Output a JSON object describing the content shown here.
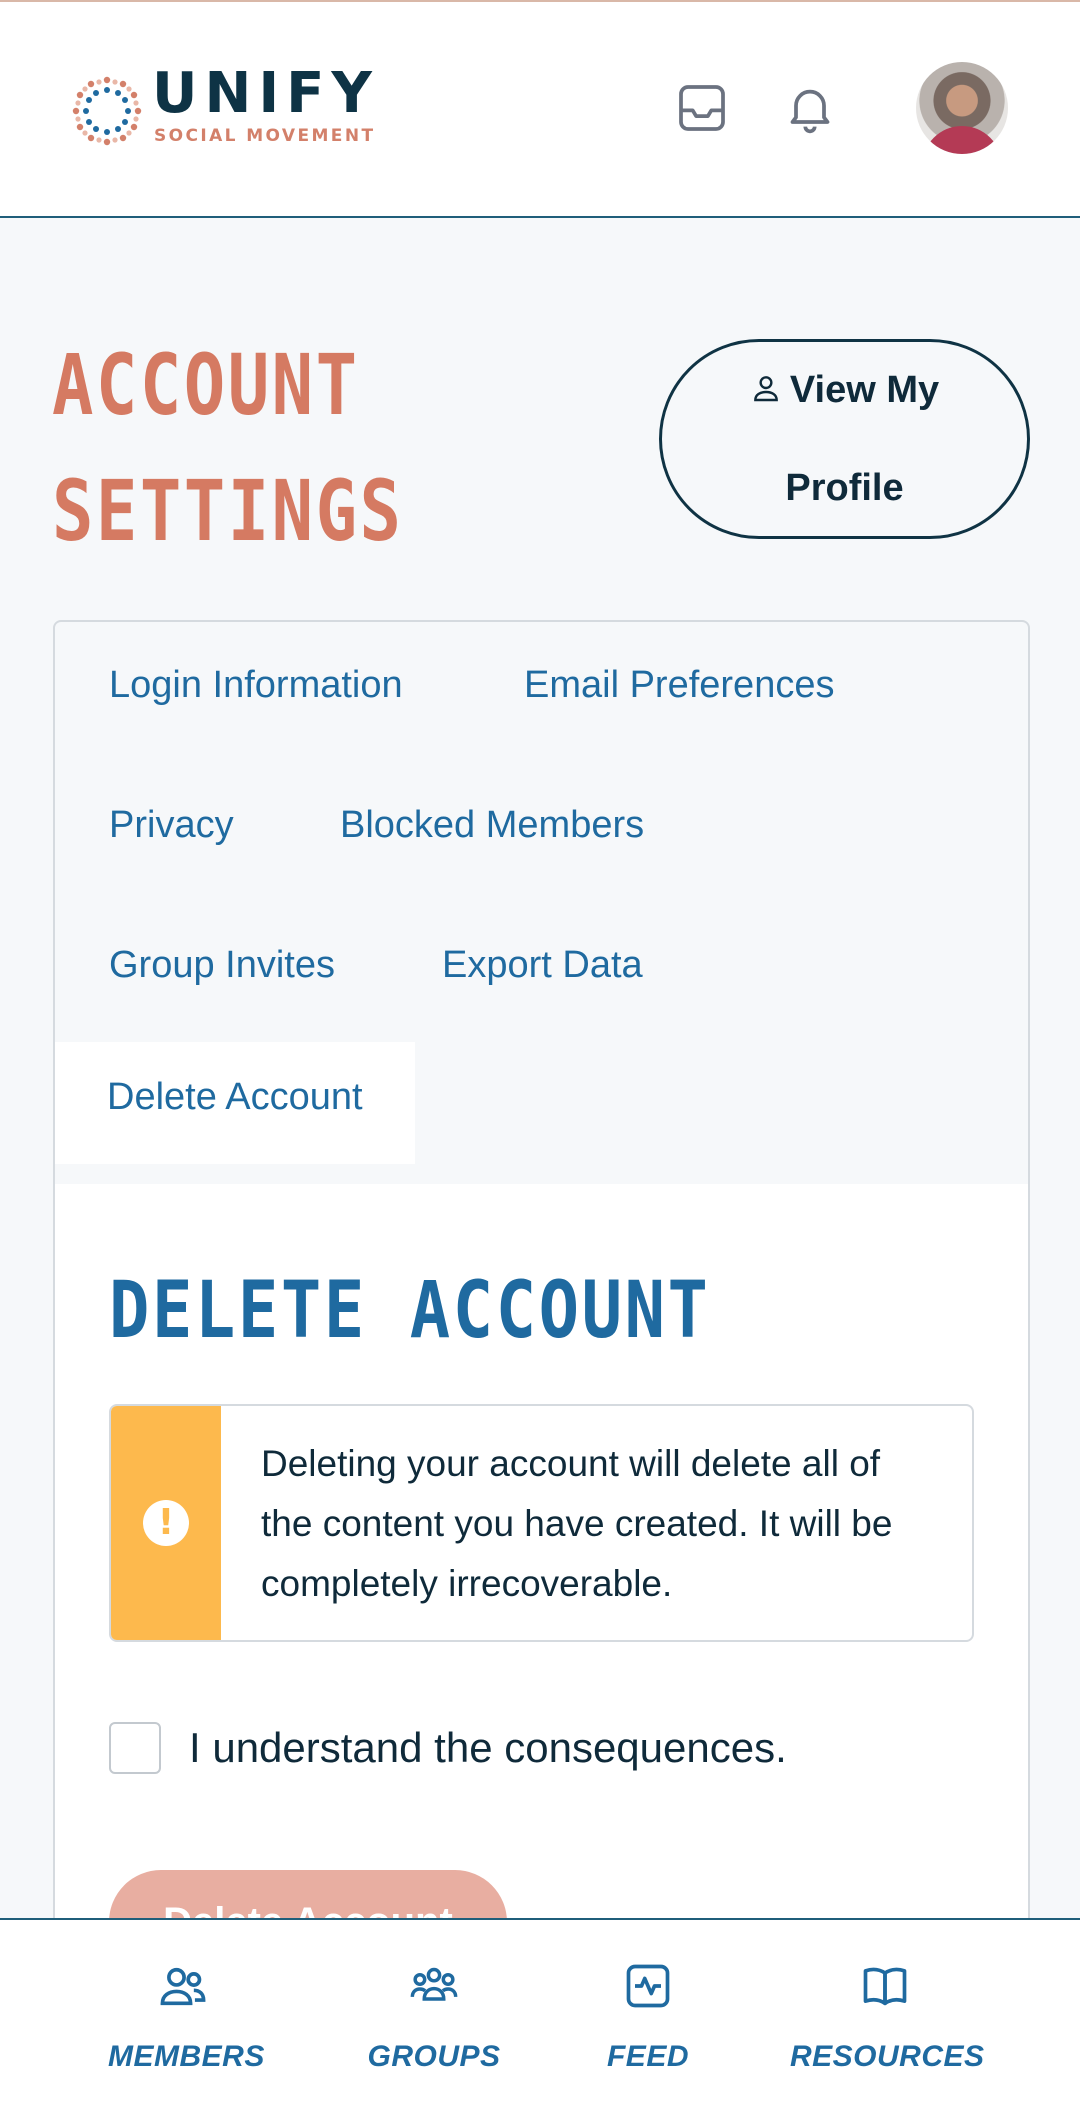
{
  "brand": {
    "name": "UNIFY",
    "tagline": "SOCIAL MOVEMENT",
    "primary_color": "#0e3345",
    "accent_color": "#d57a62",
    "link_color": "#1f6aa0"
  },
  "header": {
    "icons": [
      "inbox-icon",
      "bell-icon",
      "avatar"
    ]
  },
  "page": {
    "title_line1": "ACCOUNT",
    "title_line2": "SETTINGS",
    "view_profile_label": "View My Profile"
  },
  "tabs": [
    {
      "label": "Login Information"
    },
    {
      "label": "Email Preferences"
    },
    {
      "label": "Privacy"
    },
    {
      "label": "Blocked Members"
    },
    {
      "label": "Group Invites"
    },
    {
      "label": "Export Data"
    },
    {
      "label": "Delete Account",
      "active": true
    }
  ],
  "delete_section": {
    "title": "DELETE ACCOUNT",
    "warning": "Deleting your account will delete all of the content you have created. It will be completely irrecoverable.",
    "warning_color": "#fdb94d",
    "consent_label": "I understand the consequences.",
    "consent_checked": false,
    "button_label": "Delete Account",
    "button_enabled": false
  },
  "bottom_nav": [
    {
      "label": "MEMBERS",
      "icon": "members-icon"
    },
    {
      "label": "GROUPS",
      "icon": "groups-icon"
    },
    {
      "label": "FEED",
      "icon": "feed-icon"
    },
    {
      "label": "RESOURCES",
      "icon": "book-icon"
    }
  ]
}
